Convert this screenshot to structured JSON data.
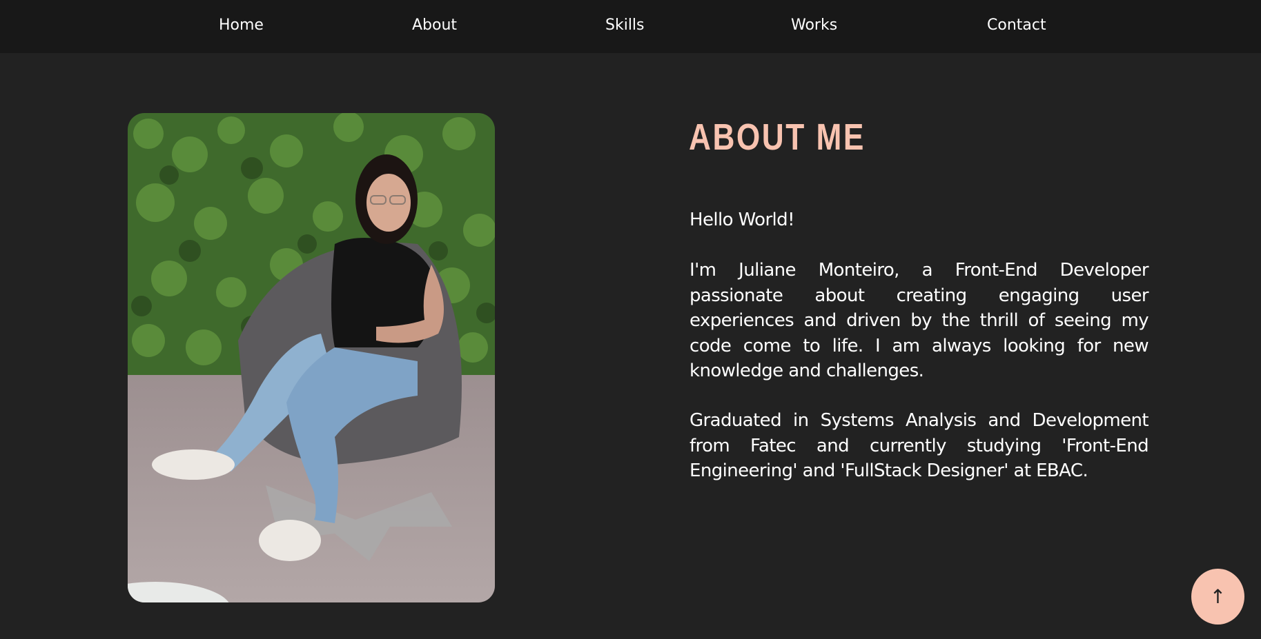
{
  "nav": {
    "items": [
      {
        "label": "Home"
      },
      {
        "label": "About"
      },
      {
        "label": "Skills"
      },
      {
        "label": "Works"
      },
      {
        "label": "Contact"
      }
    ]
  },
  "about": {
    "title": "ABOUT ME",
    "greeting": "Hello World!",
    "paragraph1": "I'm Juliane Monteiro, a Front-End Developer passionate about creating engaging user experiences and driven by the thrill of seeing my code come to life. I am always looking for new knowledge and challenges.",
    "paragraph2": "Graduated in Systems Analysis and Development from Fatec and currently studying 'Front-End Engineering' and 'FullStack Designer' at EBAC."
  },
  "back_to_top": {
    "icon": "arrow-up-icon",
    "glyph": "↑"
  },
  "colors": {
    "background": "#222222",
    "navbar": "#181818",
    "accent": "#f8c3b0",
    "text": "#ffffff"
  }
}
